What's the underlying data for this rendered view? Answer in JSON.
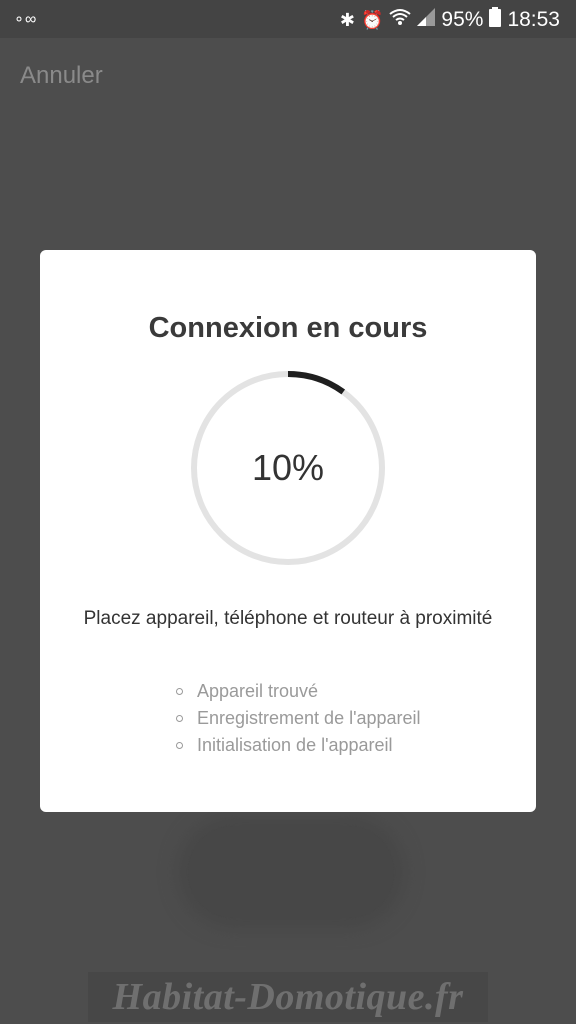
{
  "status_bar": {
    "left_icon": "notification-icon",
    "icons": [
      "bluetooth-icon",
      "alarm-icon",
      "wifi-icon",
      "signal-icon"
    ],
    "battery": "95%",
    "battery_icon": "battery-icon",
    "time": "18:53"
  },
  "header": {
    "cancel_label": "Annuler"
  },
  "modal": {
    "title": "Connexion en cours",
    "progress": {
      "label": "10%",
      "fraction": 0.1
    },
    "hint": "Placez appareil, téléphone et routeur à proximité",
    "steps": [
      "Appareil trouvé",
      "Enregistrement de l'appareil",
      "Initialisation de l'appareil"
    ]
  },
  "watermark": "Habitat-Domotique.fr",
  "colors": {
    "overlay": "#4d4d4d",
    "modal_bg": "#ffffff",
    "progress_track": "#e3e3e3",
    "progress_fill": "#1f1f1f"
  }
}
